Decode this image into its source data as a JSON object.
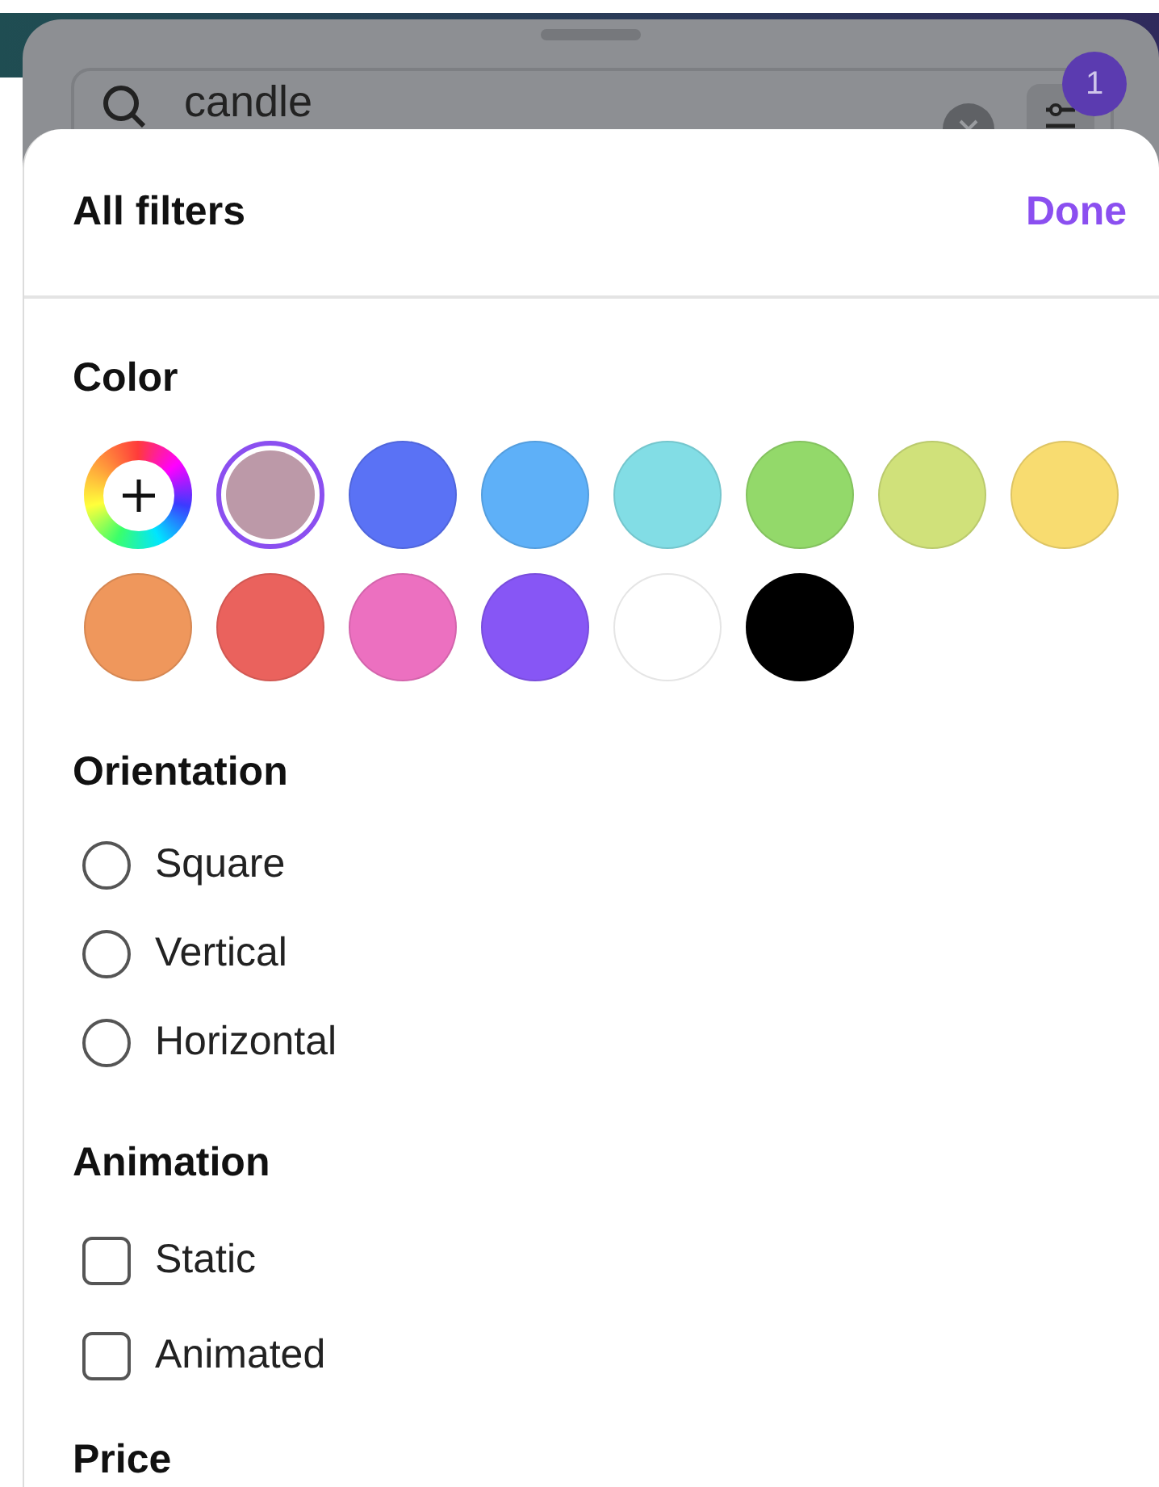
{
  "search": {
    "value": "candle",
    "filter_count": "1"
  },
  "sheet": {
    "title": "All filters",
    "done": "Done"
  },
  "color": {
    "heading": "Color",
    "swatches": [
      {
        "kind": "custom",
        "selected": false
      },
      {
        "kind": "swatch",
        "color": "#bc99a8",
        "selected": true
      },
      {
        "kind": "swatch",
        "color": "#5a72f5",
        "selected": false
      },
      {
        "kind": "swatch",
        "color": "#5eb0f8",
        "selected": false
      },
      {
        "kind": "swatch",
        "color": "#82dde5",
        "selected": false
      },
      {
        "kind": "swatch",
        "color": "#93d96a",
        "selected": false
      },
      {
        "kind": "swatch",
        "color": "#d0e17a",
        "selected": false
      },
      {
        "kind": "swatch",
        "color": "#f8dc70",
        "selected": false
      },
      {
        "kind": "swatch",
        "color": "#ef975c",
        "selected": false
      },
      {
        "kind": "swatch",
        "color": "#ea625d",
        "selected": false
      },
      {
        "kind": "swatch",
        "color": "#ec70c0",
        "selected": false
      },
      {
        "kind": "swatch",
        "color": "#8756f5",
        "selected": false
      },
      {
        "kind": "swatch",
        "color": "#ffffff",
        "selected": false
      },
      {
        "kind": "swatch",
        "color": "#000000",
        "selected": false
      }
    ]
  },
  "orientation": {
    "heading": "Orientation",
    "options": [
      {
        "label": "Square",
        "selected": false
      },
      {
        "label": "Vertical",
        "selected": false
      },
      {
        "label": "Horizontal",
        "selected": false
      }
    ]
  },
  "animation": {
    "heading": "Animation",
    "options": [
      {
        "label": "Static",
        "checked": false
      },
      {
        "label": "Animated",
        "checked": false
      }
    ]
  },
  "next_heading": "Price"
}
